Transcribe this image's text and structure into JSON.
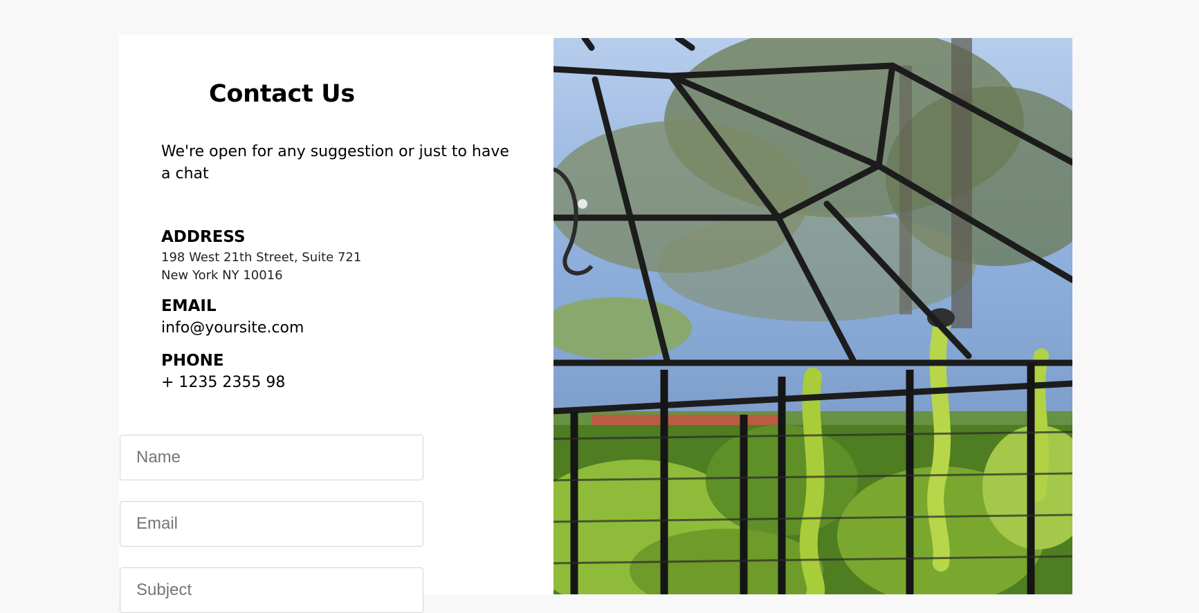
{
  "contact": {
    "title": "Contact Us",
    "intro": "We're open for any suggestion or just to have a chat"
  },
  "address": {
    "label": "ADDRESS",
    "line1": "198 West 21th Street, Suite 721",
    "line2": "New York NY 10016"
  },
  "email": {
    "label": "EMAIL",
    "value": "info@yoursite.com"
  },
  "phone": {
    "label": "PHONE",
    "value": "+ 1235 2355 98"
  },
  "form": {
    "name_placeholder": "Name",
    "email_placeholder": "Email",
    "subject_placeholder": "Subject"
  }
}
